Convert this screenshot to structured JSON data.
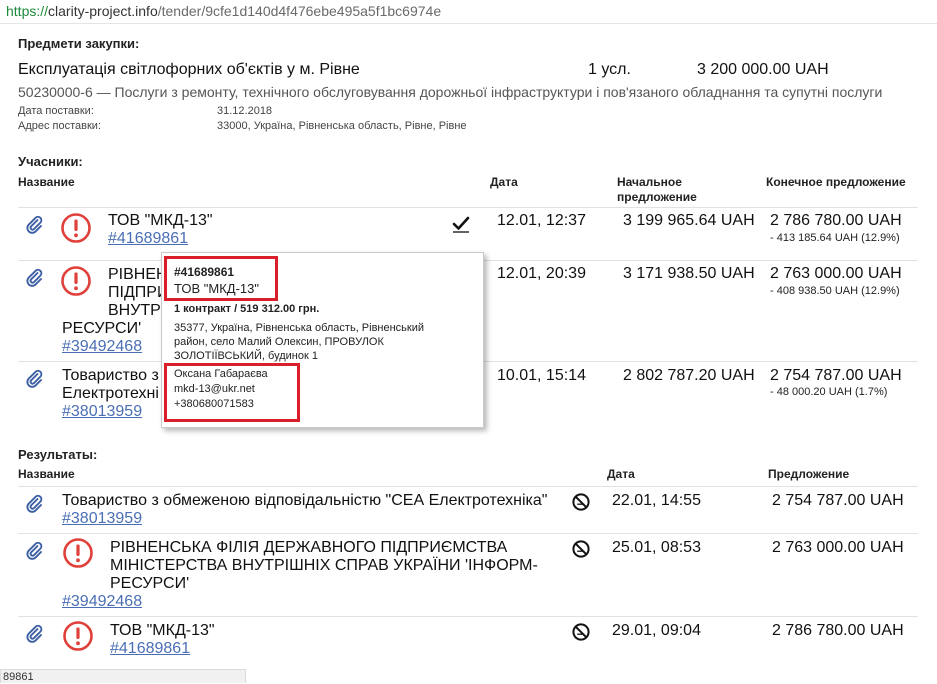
{
  "browser": {
    "url_scheme": "https://",
    "url_host": "clarity-project.info",
    "url_path": "/tender/9cfe1d140d4f476ebe495a5f1bc6974e"
  },
  "procurement": {
    "heading": "Предмети закупки:",
    "title": "Експлуатація світлофорних об'єктів у м. Рівне",
    "quantity": "1 усл.",
    "amount": "3 200 000.00 UAH",
    "cpv": "50230000-6 — Послуги з ремонту, технічного обслуговування дорожньої інфраструктури і пов'язаного обладнання та супутні послуги",
    "delivery_date_label": "Дата поставки:",
    "delivery_date": "31.12.2018",
    "delivery_address_label": "Адрес поставки:",
    "delivery_address": "33000, Україна, Рівненська область, Рівне, Рівне"
  },
  "participants": {
    "heading": "Учасники:",
    "columns": {
      "name": "Название",
      "date": "Дата",
      "initial": "Начальное предложение",
      "final": "Конечное предложение"
    },
    "rows": [
      {
        "name": "ТОВ \"МКД-13\"",
        "code": "#41689861",
        "date": "12.01, 12:37",
        "initial": "3 199 965.64 UAH",
        "final": "2 786 780.00 UAH",
        "diff": "- 413 185.64 UAH (12.9%)"
      },
      {
        "name": "РІВНЕНСЬКА ФІЛІЯ ДЕРЖАВНОГО ПІДПРИЄМСТВА МІНІСТЕРСТВА ВНУТРІШНІХ СПРАВ УКРАЇНИ 'ІНФОРМ-РЕСУРСИ'",
        "name_visible_lines": [
          "РІВНЕН",
          "ПІДПРИ",
          "ВНУТР",
          "РЕСУРСИ'"
        ],
        "code": "#39492468",
        "date": "12.01, 20:39",
        "initial": "3 171 938.50 UAH",
        "final": "2 763 000.00 UAH",
        "diff": "- 408 938.50 UAH (12.9%)"
      },
      {
        "name_visible_lines": [
          "Товариство з",
          "Електротехні"
        ],
        "code": "#38013959",
        "date": "10.01, 15:14",
        "initial": "2 802 787.20 UAH",
        "final": "2 754 787.00 UAH",
        "diff": "- 48 000.20 UAH (1.7%)"
      }
    ]
  },
  "tooltip": {
    "code": "#41689861",
    "name": "ТОВ \"МКД-13\"",
    "contracts": "1 контракт / 519 312.00 грн.",
    "address_lines": [
      "35377, Україна, Рівненська область, Рівненський",
      "район, село Малий Олексин, ПРОВУЛОК",
      "ЗОЛОТІЇВСЬКИЙ, будинок 1"
    ],
    "contact_name": "Оксана Габараєва",
    "email": "mkd-13@ukr.net",
    "phone": "+380680071583"
  },
  "results": {
    "heading": "Результаты:",
    "columns": {
      "name": "Название",
      "date": "Дата",
      "offer": "Предложение"
    },
    "rows": [
      {
        "name": "Товариство з обмеженою відповідальністю \"СЕА Електротехніка\"",
        "code": "#38013959",
        "date": "22.01, 14:55",
        "offer": "2 754 787.00 UAH"
      },
      {
        "name_lines": [
          "РІВНЕНСЬКА ФІЛІЯ ДЕРЖАВНОГО ПІДПРИЄМСТВА",
          "МІНІСТЕРСТВА ВНУТРІШНІХ СПРАВ УКРАЇНИ 'ІНФОРМ-",
          "РЕСУРСИ'"
        ],
        "code": "#39492468",
        "date": "25.01, 08:53",
        "offer": "2 763 000.00 UAH"
      },
      {
        "name": "ТОВ \"МКД-13\"",
        "code": "#41689861",
        "date": "29.01, 09:04",
        "offer": "2 786 780.00 UAH"
      }
    ]
  },
  "status_bar": {
    "text": "89861"
  },
  "colors": {
    "link": "#4a6fb5",
    "warning": "#e0403a",
    "highlight": "#d9202a",
    "url_scheme": "#1e8a3a"
  }
}
